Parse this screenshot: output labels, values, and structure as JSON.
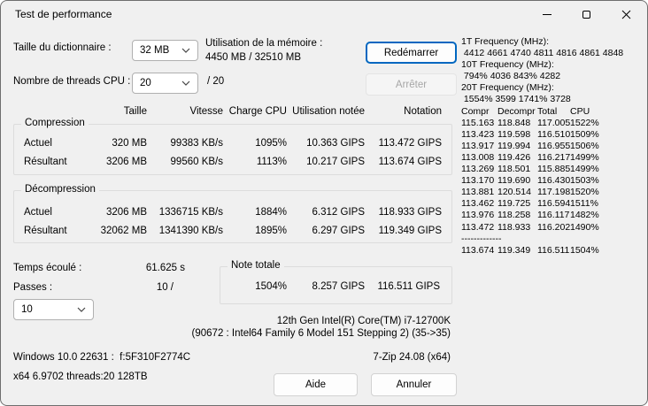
{
  "window": {
    "title": "Test de performance"
  },
  "controls": {
    "dictionary_label": "Taille du dictionnaire :",
    "dictionary_value": "32 MB",
    "memory_label": "Utilisation de la mémoire :",
    "memory_value": "4450 MB / 32510 MB",
    "threads_label": "Nombre de threads CPU :",
    "threads_value": "20",
    "threads_total": "/ 20",
    "restart_button": "Redémarrer",
    "stop_button": "Arrêter"
  },
  "table": {
    "headers": [
      "Taille",
      "Vitesse",
      "Charge CPU",
      "Utilisation notée",
      "Notation"
    ],
    "compression": {
      "title": "Compression",
      "rows": [
        {
          "label": "Actuel",
          "size": "320 MB",
          "speed": "99383 KB/s",
          "cpu": "1095%",
          "usage": "10.363 GIPS",
          "rating": "113.472 GIPS"
        },
        {
          "label": "Résultant",
          "size": "3206 MB",
          "speed": "99560 KB/s",
          "cpu": "1113%",
          "usage": "10.217 GIPS",
          "rating": "113.674 GIPS"
        }
      ]
    },
    "decompression": {
      "title": "Décompression",
      "rows": [
        {
          "label": "Actuel",
          "size": "3206 MB",
          "speed": "1336715 KB/s",
          "cpu": "1884%",
          "usage": "6.312 GIPS",
          "rating": "118.933 GIPS"
        },
        {
          "label": "Résultant",
          "size": "32062 MB",
          "speed": "1341390 KB/s",
          "cpu": "1895%",
          "usage": "6.297 GIPS",
          "rating": "119.349 GIPS"
        }
      ]
    }
  },
  "totals": {
    "elapsed_label": "Temps écoulé :",
    "elapsed_value": "61.625 s",
    "passes_label": "Passes :",
    "passes_value": "10 /",
    "passes_selector": "10",
    "note_title": "Note totale",
    "note_cpu": "1504%",
    "note_usage": "8.257 GIPS",
    "note_rating": "116.511 GIPS"
  },
  "log": {
    "freq_lines": [
      "1T Frequency (MHz):",
      " 4412 4661 4740 4811 4816 4861 4848",
      "10T Frequency (MHz):",
      " 794% 4036 843% 4282",
      "20T Frequency (MHz):",
      " 1554% 3599 1741% 3728"
    ],
    "table_header": [
      "Compr",
      "Decompr",
      "Total",
      "CPU"
    ],
    "rows": [
      [
        "115.163",
        "118.848",
        "117.005",
        "1522%"
      ],
      [
        "113.423",
        "119.598",
        "116.510",
        "1509%"
      ],
      [
        "113.917",
        "119.994",
        "116.955",
        "1506%"
      ],
      [
        "113.008",
        "119.426",
        "116.217",
        "1499%"
      ],
      [
        "113.269",
        "118.501",
        "115.885",
        "1499%"
      ],
      [
        "113.170",
        "119.690",
        "116.430",
        "1503%"
      ],
      [
        "113.881",
        "120.514",
        "117.198",
        "1520%"
      ],
      [
        "113.462",
        "119.725",
        "116.594",
        "1511%"
      ],
      [
        "113.976",
        "118.258",
        "116.117",
        "1482%"
      ],
      [
        "113.472",
        "118.933",
        "116.202",
        "1490%"
      ]
    ],
    "separator": "-------------",
    "avg_row": [
      "113.674",
      "119.349",
      "116.511",
      "1504%"
    ]
  },
  "footer": {
    "cpu_line1": "12th Gen Intel(R) Core(TM) i7-12700K",
    "cpu_line2": "(90672 : Intel64 Family 6 Model 151 Stepping 2) (35->35)",
    "windows_line": "Windows 10.0 22631 :  f:5F310F2774C",
    "sevenzip_version": "7-Zip 24.08 (x64)",
    "arch_line": "x64 6.9702 threads:20 128TB",
    "help_button": "Aide",
    "cancel_button": "Annuler"
  },
  "colors": {
    "accent_blue": "#0067c0",
    "dialog_bg": "#f0f0f0",
    "disabled_text": "#a6a6a6"
  }
}
